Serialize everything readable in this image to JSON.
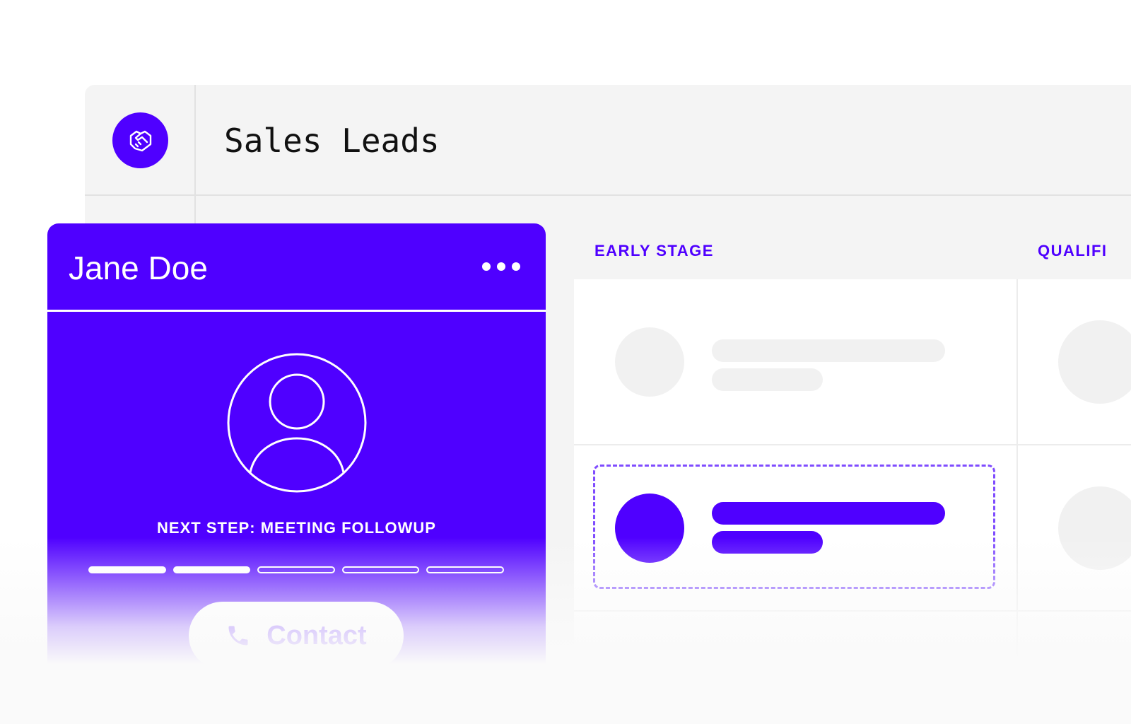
{
  "app": {
    "title": "Sales Leads",
    "logo_icon": "handshake-icon",
    "accent_color": "#4f00ff"
  },
  "board": {
    "columns": [
      {
        "label": "EARLY STAGE"
      },
      {
        "label": "QUALIFI"
      }
    ]
  },
  "lead_card": {
    "name": "Jane Doe",
    "menu_icon": "more-horizontal-icon",
    "avatar_icon": "user-avatar-icon",
    "next_step": "NEXT STEP: MEETING FOLLOWUP",
    "progress": {
      "completed_steps": 2,
      "total_steps": 5
    },
    "contact_button": {
      "label": "Contact",
      "icon": "phone-icon"
    }
  }
}
